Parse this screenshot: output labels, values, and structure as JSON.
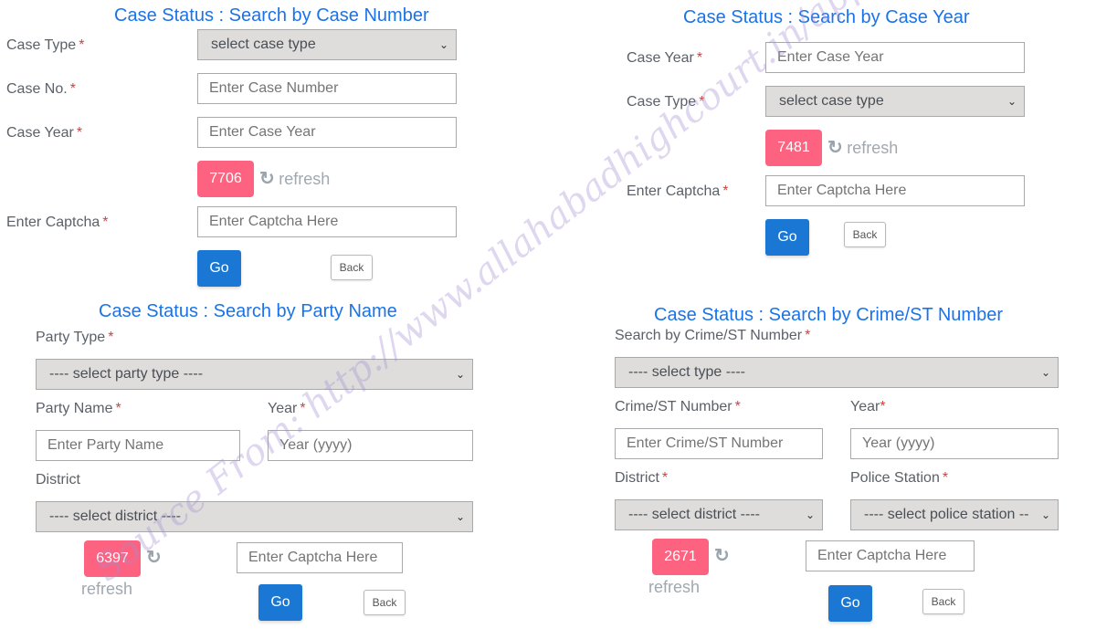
{
  "required_mark": "*",
  "panels": {
    "case_number": {
      "title": "Case Status : Search by Case Number",
      "case_type_label": "Case Type",
      "case_type_select": "select case type",
      "case_no_label": "Case No.",
      "case_no_placeholder": "Enter Case Number",
      "case_year_label": "Case Year",
      "case_year_placeholder": "Enter Case Year",
      "captcha_code": "7706",
      "refresh_label": "refresh",
      "captcha_label": "Enter Captcha",
      "captcha_placeholder": "Enter Captcha Here",
      "go_label": "Go",
      "back_label": "Back"
    },
    "case_year": {
      "title": "Case Status : Search by Case Year",
      "case_year_label": "Case Year",
      "case_year_placeholder": "Enter Case Year",
      "case_type_label": "Case Type",
      "case_type_select": "select case type",
      "captcha_code": "7481",
      "refresh_label": "refresh",
      "captcha_label": "Enter Captcha",
      "captcha_placeholder": "Enter Captcha Here",
      "go_label": "Go",
      "back_label": "Back"
    },
    "party_name": {
      "title": "Case Status : Search by Party Name",
      "party_type_label": "Party Type",
      "party_type_select": "---- select party type ----",
      "party_name_label": "Party Name",
      "party_name_placeholder": "Enter Party Name",
      "year_label": "Year",
      "year_placeholder": "Year (yyyy)",
      "district_label": "District",
      "district_select": "---- select district ----",
      "captcha_code": "6397",
      "refresh_label": "refresh",
      "captcha_placeholder": "Enter Captcha Here",
      "go_label": "Go",
      "back_label": "Back"
    },
    "crime_st": {
      "title": "Case Status : Search by Crime/ST Number",
      "search_by_label": "Search by Crime/ST Number",
      "type_select": "---- select type ----",
      "crime_no_label": "Crime/ST Number",
      "crime_no_placeholder": "Enter Crime/ST Number",
      "year_label": "Year",
      "year_placeholder": "Year (yyyy)",
      "district_label": "District",
      "district_select": "---- select district ----",
      "police_station_label": "Police Station",
      "police_station_select": "---- select police station --",
      "captcha_code": "2671",
      "refresh_label": "refresh",
      "captcha_placeholder": "Enter Captcha Here",
      "go_label": "Go",
      "back_label": "Back"
    }
  },
  "watermark": "Source From: http://www.allahabadhighcourt.in/apps/status/",
  "colors": {
    "title": "#1a73e8",
    "captcha_bg": "#fd6380",
    "go_bg": "#1a78d4",
    "select_bg": "#dedddc",
    "required": "#e53935"
  }
}
